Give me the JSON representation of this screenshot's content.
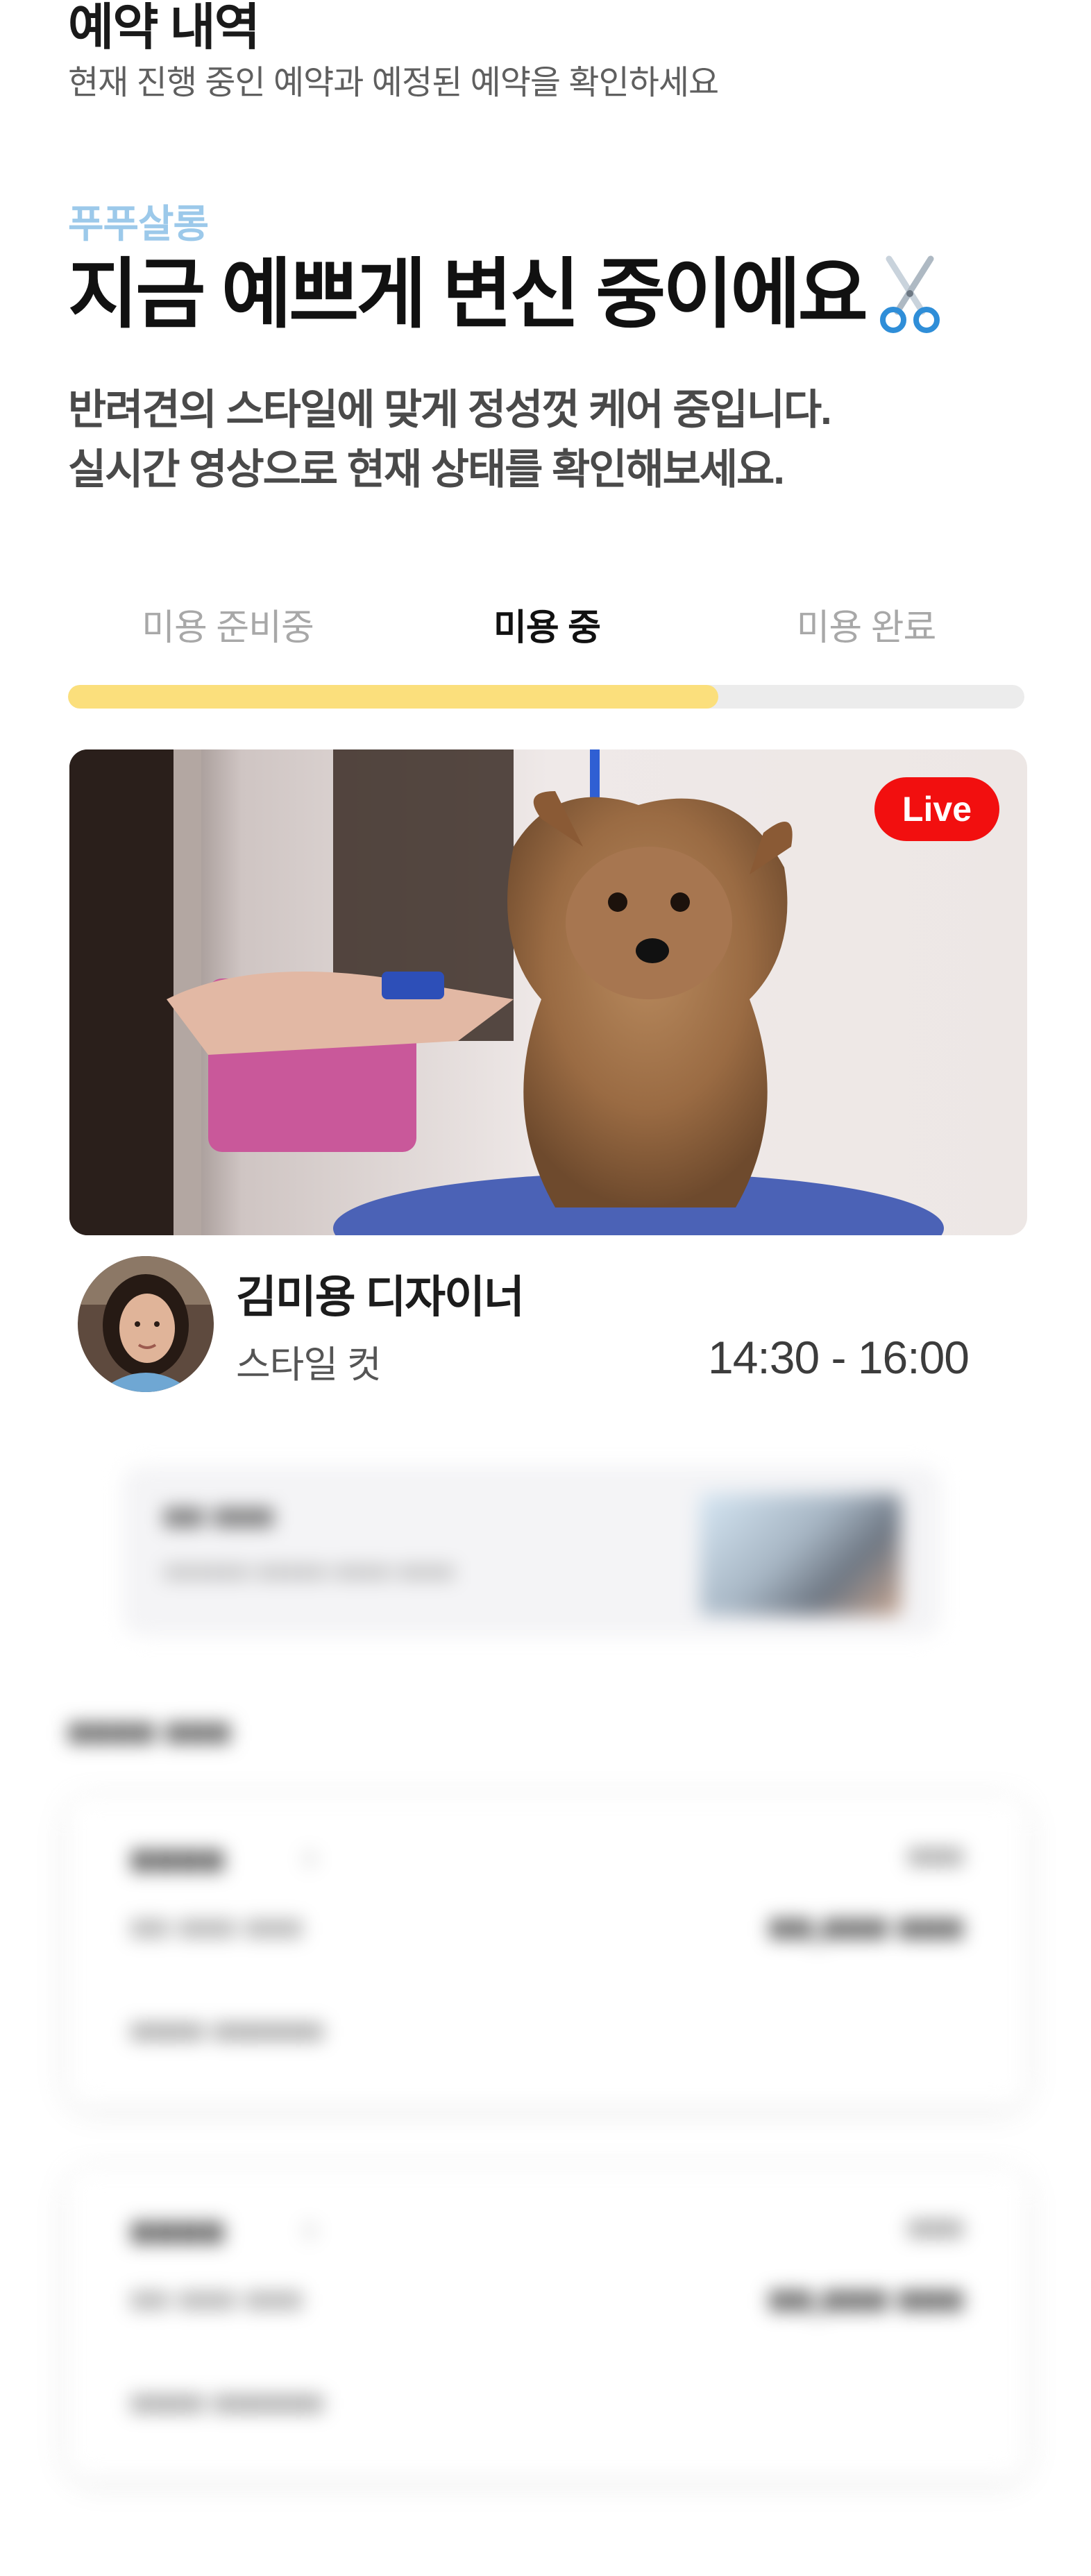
{
  "header": {
    "title": "예약 내역",
    "subtitle": "현재 진행 중인 예약과 예정된 예약을 확인하세요"
  },
  "hero": {
    "salon_name": "푸푸살롱",
    "headline": "지금 예쁘게 변신 중이에요",
    "headline_icon": "scissors-icon",
    "description_line1": "반려견의 스타일에 맞게 정성껏 케어 중입니다.",
    "description_line2": "실시간 영상으로 현재 상태를 확인해보세요."
  },
  "progress": {
    "steps": [
      "미용 준비중",
      "미용 중",
      "미용 완료"
    ],
    "active_index": 1,
    "fill_fraction": 0.68,
    "fill_color": "#fbdf7c",
    "track_color": "#ececec"
  },
  "live_video": {
    "badge": "Live",
    "badge_color": "#f20f0f"
  },
  "designer": {
    "name": "김미용 디자이너",
    "service": "스타일 컷",
    "time_range": "14:30 - 16:00"
  }
}
